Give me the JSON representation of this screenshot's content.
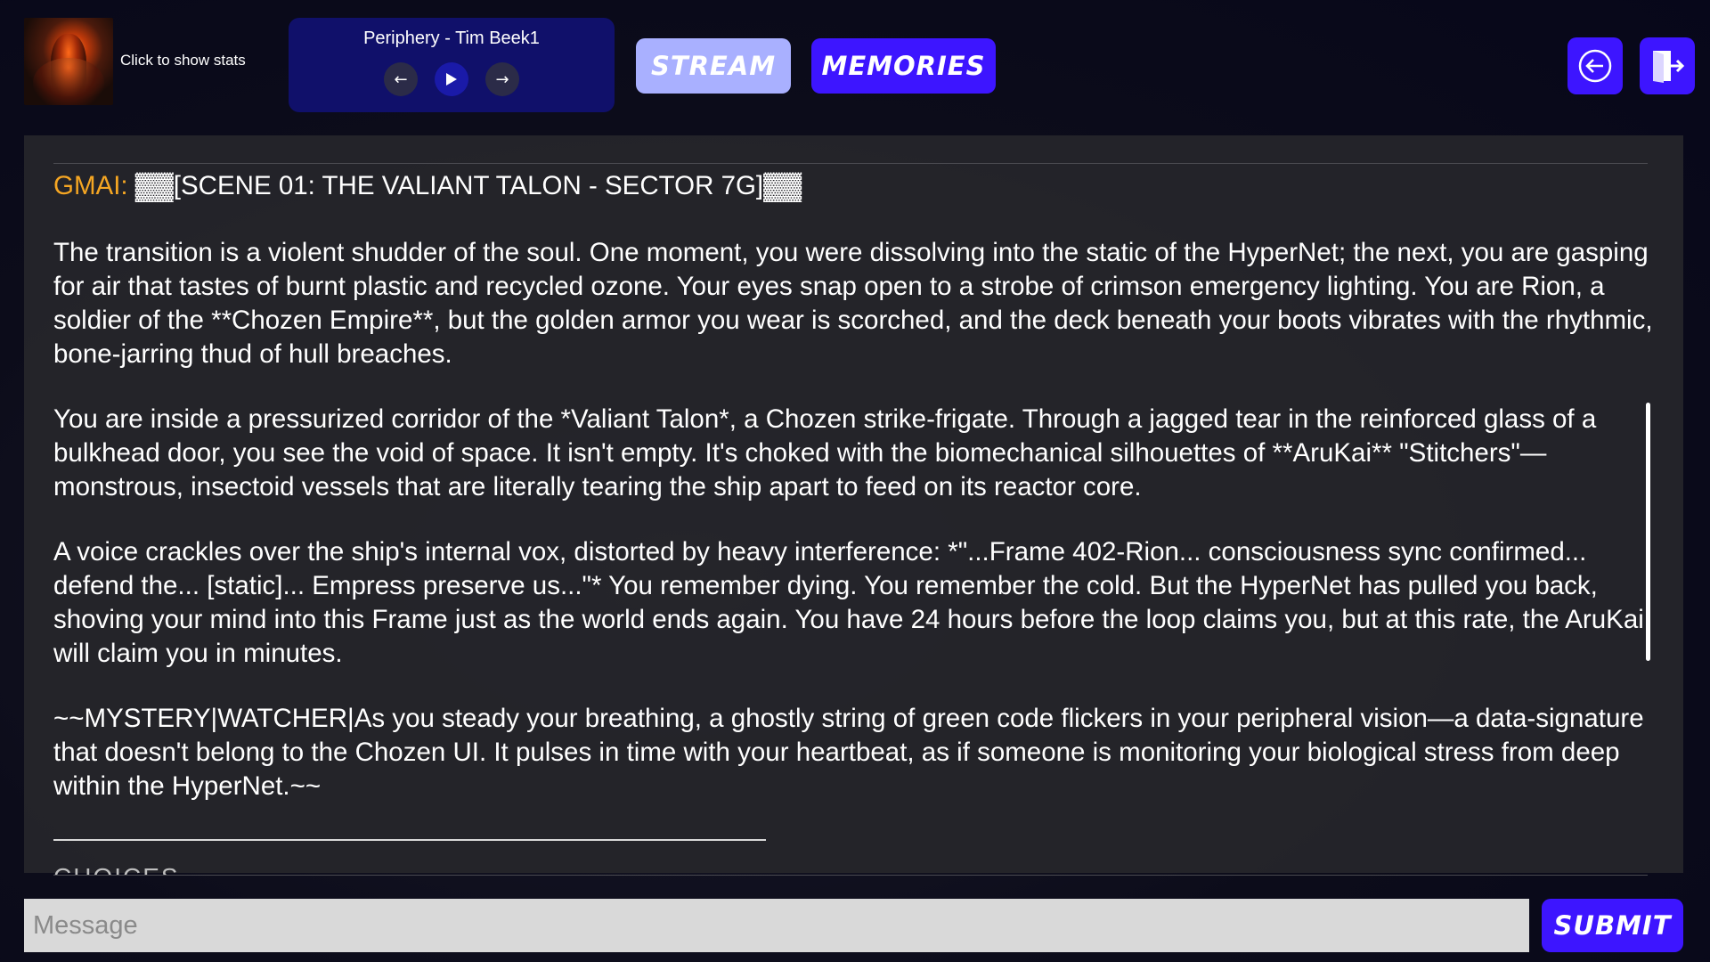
{
  "header": {
    "stats_hint": "Click to show stats",
    "player": {
      "track": "Periphery - Tim Beek1",
      "prev_icon": "arrow-left-icon",
      "play_icon": "play-icon",
      "next_icon": "arrow-right-icon"
    },
    "tabs": {
      "stream": "STREAM",
      "memories": "MEMORIES"
    },
    "back_icon": "circle-arrow-left-icon",
    "logout_icon": "door-exit-icon"
  },
  "chat": {
    "speaker": "GMAI:",
    "scene_title": "▓▓[SCENE 01: THE VALIANT TALON - SECTOR 7G]▓▓",
    "paragraphs": [
      "The transition is a violent shudder of the soul. One moment, you were dissolving into the static of the HyperNet; the next, you are gasping for air that tastes of burnt plastic and recycled ozone. Your eyes snap open to a strobe of crimson emergency lighting. You are Rion, a soldier of the **Chozen Empire**, but the golden armor you wear is scorched, and the deck beneath your boots vibrates with the rhythmic, bone-jarring thud of hull breaches.",
      "You are inside a pressurized corridor of the *Valiant Talon*, a Chozen strike-frigate. Through a jagged tear in the reinforced glass of a bulkhead door, you see the void of space. It isn't empty. It's choked with the biomechanical silhouettes of **AruKai** \"Stitchers\"—monstrous, insectoid vessels that are literally tearing the ship apart to feed on its reactor core.",
      "A voice crackles over the ship's internal vox, distorted by heavy interference: *\"...Frame 402-Rion... consciousness sync confirmed... defend the... [static]... Empress preserve us...\"* You remember dying. You remember the cold. But the HyperNet has pulled you back, shoving your mind into this Frame just as the world ends again. You have 24 hours before the loop claims you, but at this rate, the AruKai will claim you in minutes.",
      "~~MYSTERY|WATCHER|As you steady your breathing, a ghostly string of green code flickers in your peripheral vision—a data-signature that doesn't belong to the Chozen UI. It pulses in time with your heartbeat, as if someone is monitoring your biological stress from deep within the HyperNet.~~"
    ],
    "choices_peek": "CHOICES"
  },
  "input": {
    "placeholder": "Message",
    "submit_label": "SUBMIT"
  },
  "colors": {
    "accent": "#3d15ff",
    "stream_tab": "#a9b0ff",
    "speaker": "#f5a623",
    "player_bg": "#10106a"
  }
}
